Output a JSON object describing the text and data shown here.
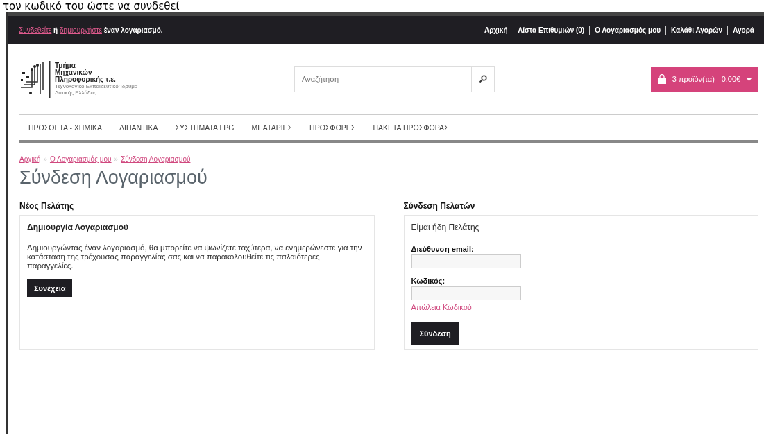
{
  "document_caption": "τον κωδικό του ώστε να συνδεθεί",
  "top_bar": {
    "welcome": {
      "login_link": "Συνδεθείτε",
      "middle": "ή",
      "register_link": "δημιουργήστε",
      "tail": "έναν λογαριασμό."
    },
    "links": [
      "Αρχική",
      "Λίστα Επιθυμιών (0)",
      "Ο Λογαριασμός μου",
      "Καλάθι Αγορών",
      "Αγορά"
    ]
  },
  "logo": {
    "lines": [
      "Τμήμα",
      "Μηχανικών",
      "Πληροφορικής τ.ε."
    ],
    "subtitle": [
      "Τεχνολογικό Εκπαιδευτικό Ίδρυμα",
      "Δυτικής Ελλάδος"
    ]
  },
  "search": {
    "placeholder": "Αναζήτηση"
  },
  "cart": {
    "label": "3 προϊόν(τα) - 0,00€"
  },
  "nav": [
    "ΠΡΟΣΘΕΤΑ - ΧΗΜΙΚΑ",
    "ΛΙΠΑΝΤΙΚΑ",
    "ΣΥΣΤΗΜΑΤΑ LPG",
    "ΜΠΑΤΑΡΙΕΣ",
    "ΠΡΟΣΦΟΡΕΣ",
    "ΠΑΚΕΤΑ ΠΡΟΣΦΟΡΑΣ"
  ],
  "breadcrumb": [
    "Αρχική",
    "Ο Λογαριασμός μου",
    "Σύνδεση Λογαριασμού"
  ],
  "breadcrumb_separator": "»",
  "title": "Σύνδεση Λογαριασμού",
  "new_customer": {
    "heading": "Νέος Πελάτης",
    "box_title": "Δημιουργία Λογαριασμού",
    "text": "Δημιουργώντας έναν λογαριασμό, θα μπορείτε να ψωνίζετε ταχύτερα, να ενημερώνεστε για την κατάσταση της τρέχουσας παραγγελίας σας και να παρακολουθείτε τις παλαιότερες παραγγελίες.",
    "button": "Συνέχεια"
  },
  "returning_customer": {
    "heading": "Σύνδεση Πελατών",
    "box_title": "Είμαι ήδη Πελάτης",
    "email_label": "Διεύθυνση email:",
    "password_label": "Κωδικός:",
    "forgot_link": "Απώλεια Κωδικού",
    "button": "Σύνδεση"
  }
}
